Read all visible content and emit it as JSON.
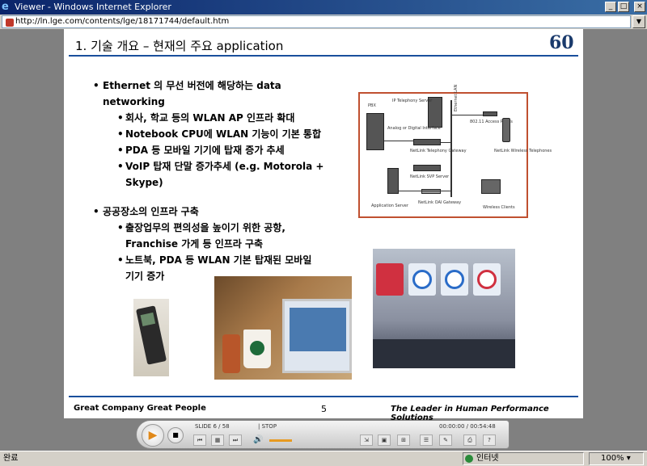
{
  "window": {
    "title": "Viewer - Windows Internet Explorer",
    "minimize": "_",
    "maximize": "□",
    "close": "×"
  },
  "address": {
    "url": "http://ln.lge.com/contents/lge/18171744/default.htm"
  },
  "slide": {
    "title": "1. 기술 개요 – 현재의 주요 application",
    "logo": "60",
    "bullets": [
      {
        "level": 1,
        "text": "Ethernet 의 무선 버전에 해당하는 data"
      },
      {
        "level": 1,
        "text": "networking",
        "cont": true
      },
      {
        "level": 2,
        "text": "회사, 학교 등의 WLAN AP 인프라 확대"
      },
      {
        "level": 2,
        "text": "Notebook CPU에 WLAN 기능이 기본 통합"
      },
      {
        "level": 2,
        "text": "PDA 등 모바일 기기에 탑재 증가 추세"
      },
      {
        "level": 2,
        "text": "VoIP 탑재 단말 증가추세 (e.g. Motorola +"
      },
      {
        "level": 2,
        "text": "Skype)",
        "cont": true
      },
      {
        "level": 0,
        "text": ""
      },
      {
        "level": 1,
        "text": "공공장소의 인프라 구축"
      },
      {
        "level": 2,
        "text": "출장업무의 편의성을 높이기 위한 공항,"
      },
      {
        "level": 2,
        "text": "Franchise 가게 등 인프라 구축",
        "cont": true
      },
      {
        "level": 2,
        "text": "노트북, PDA 등 WLAN 기본 탑재된 모바일"
      },
      {
        "level": 2,
        "text": "기기 증가",
        "cont": true
      }
    ],
    "diagram_labels": {
      "pbx": "PBX",
      "ip_server": "IP Telephony Server",
      "ethernet_lan": "Ethernet LAN",
      "access_points": "802.11 Access Points",
      "analog": "Analog or Digital Interface",
      "gateway": "NetLink Telephony Gateway",
      "wireless_tel": "NetLink Wireless Telephones",
      "svp": "NetLink SVP Server",
      "app_server": "Application Server",
      "oai": "NetLink OAI Gateway",
      "clients": "Wireless Clients"
    },
    "footer": {
      "left": "Great Company   Great People",
      "page": "5",
      "right": "The Leader in Human Performance Solutions"
    }
  },
  "player": {
    "slide_info": "SLIDE 6 /   58",
    "stop_label": "| STOP",
    "time": "00:00:00 / 00:54:48"
  },
  "status": {
    "text": "완료",
    "zone": "인터넷",
    "zoom": "100%"
  },
  "colors": {
    "accent": "#1a4f9c",
    "diagram_border": "#c05030"
  }
}
